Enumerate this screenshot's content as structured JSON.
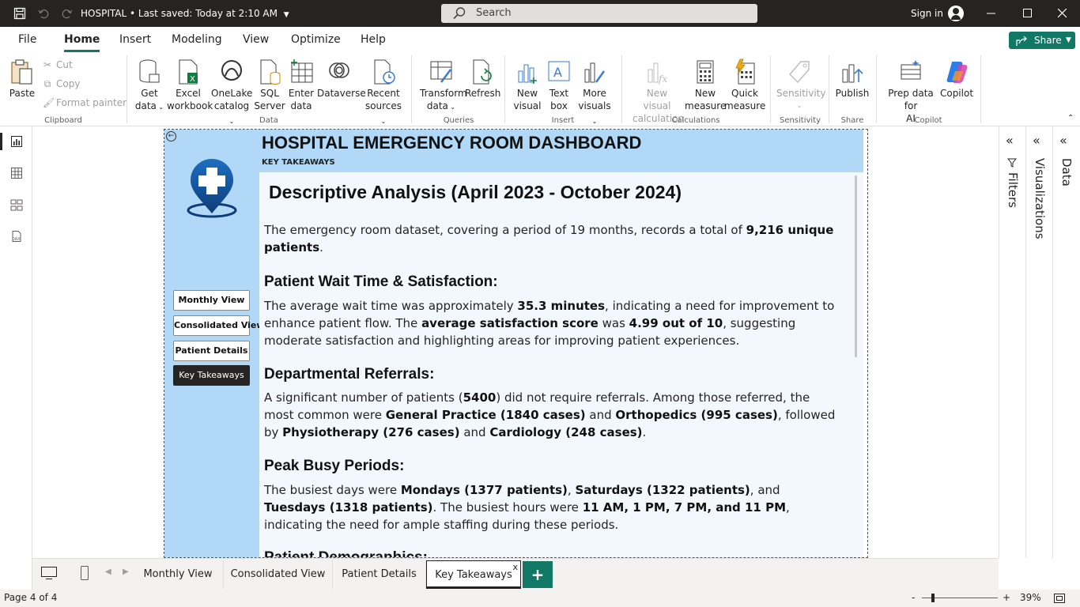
{
  "titlebar": {
    "title": "HOSPITAL",
    "saved": "• Last saved: Today at 2:10 AM",
    "search_placeholder": "Search",
    "signin": "Sign in"
  },
  "menu": {
    "tabs": [
      "File",
      "Home",
      "Insert",
      "Modeling",
      "View",
      "Optimize",
      "Help"
    ],
    "active": "Home",
    "share": "Share"
  },
  "ribbon": {
    "clipboard": {
      "paste": "Paste",
      "cut": "Cut",
      "copy": "Copy",
      "format_painter": "Format painter",
      "group": "Clipboard"
    },
    "data": {
      "get_data": "Get",
      "get_data2": "data",
      "excel": "Excel",
      "excel2": "workbook",
      "onelake": "OneLake",
      "onelake2": "catalog",
      "sql": "SQL",
      "sql2": "Server",
      "enter": "Enter",
      "enter2": "data",
      "dataverse": "Dataverse",
      "recent": "Recent",
      "recent2": "sources",
      "group": "Data"
    },
    "queries": {
      "transform": "Transform",
      "transform2": "data",
      "refresh": "Refresh",
      "group": "Queries"
    },
    "insert": {
      "new_visual": "New",
      "new_visual2": "visual",
      "text_box": "Text",
      "text_box2": "box",
      "more_visuals": "More",
      "more_visuals2": "visuals",
      "group": "Insert"
    },
    "calculations": {
      "new_visual_calc": "New visual",
      "new_visual_calc2": "calculation",
      "new_measure": "New",
      "new_measure2": "measure",
      "quick_measure": "Quick",
      "quick_measure2": "measure",
      "group": "Calculations"
    },
    "sensitivity": {
      "label": "Sensitivity",
      "group": "Sensitivity"
    },
    "share": {
      "publish": "Publish",
      "group": "Share"
    },
    "copilot": {
      "prep": "Prep data for",
      "prep2": "AI",
      "copilot": "Copilot",
      "group": "Copilot"
    }
  },
  "report": {
    "title": "HOSPITAL EMERGENCY ROOM DASHBOARD",
    "subtitle": "KEY TAKEAWAYS",
    "nav_buttons": [
      "Monthly View",
      "Consolidated View",
      "Patient Details",
      "Key Takeaways"
    ],
    "heading": "Descriptive Analysis (April 2023 - October 2024)",
    "intro_a": " The emergency room dataset, covering a period of 19 months, records a total of ",
    "intro_b": "9,216 unique patients",
    "intro_c": ".",
    "s1_title": "Patient Wait Time & Satisfaction:",
    "s1_a": "The average wait time was approximately ",
    "s1_b": "35.3 minutes",
    "s1_c": ", indicating a need for improvement to enhance patient flow. The ",
    "s1_d": "average satisfaction score",
    "s1_e": " was ",
    "s1_f": "4.99 out of 10",
    "s1_g": ", suggesting moderate satisfaction and highlighting areas for improving patient experiences.",
    "s2_title": "Departmental Referrals:",
    "s2_a": "A significant number of patients (",
    "s2_b": "5400",
    "s2_c": ") did not require referrals. Among those referred, the most common were ",
    "s2_d": "General Practice (1840 cases)",
    "s2_e": " and ",
    "s2_f": "Orthopedics (995 cases)",
    "s2_g": ", followed by ",
    "s2_h": "Physiotherapy (276 cases)",
    "s2_i": " and ",
    "s2_j": "Cardiology (248 cases)",
    "s2_k": ".",
    "s3_title": "Peak Busy Periods:",
    "s3_a": "The busiest days were ",
    "s3_b": "Mondays (1377 patients)",
    "s3_c": ", ",
    "s3_d": "Saturdays (1322 patients)",
    "s3_e": ", and ",
    "s3_f": "Tuesdays (1318 patients)",
    "s3_g": ". The busiest hours were ",
    "s3_h": "11 AM, 1 PM, 7 PM, and 11 PM",
    "s3_i": ", indicating the need for ample staffing during these periods.",
    "s4_title": "Patient Demographics:"
  },
  "panes": {
    "filters": "Filters",
    "visualizations": "Visualizations",
    "data": "Data"
  },
  "page_tabs": [
    "Monthly View",
    "Consolidated View",
    "Patient Details",
    "Key Takeaways"
  ],
  "active_page": "Key Takeaways",
  "status": {
    "page": "Page 4 of 4",
    "zoom": "39%"
  },
  "colors": {
    "accent": "#117865",
    "report_blue": "#b1d8f7",
    "panel_bg": "#f2f8fe",
    "titlebar": "#252423"
  }
}
